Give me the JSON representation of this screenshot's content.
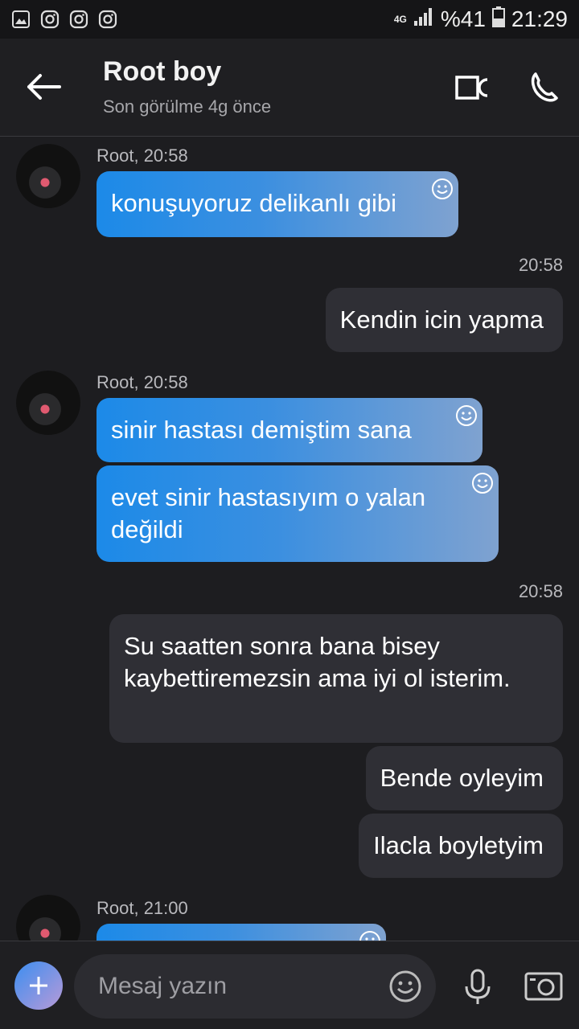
{
  "status_bar": {
    "network": "4G",
    "battery": "%41",
    "time": "21:29",
    "icons": [
      "gallery-icon",
      "instagram-icon",
      "instagram-icon",
      "instagram-icon"
    ]
  },
  "header": {
    "title": "Root boy",
    "subtitle": "Son görülme 4g önce"
  },
  "messages": [
    {
      "type": "incoming",
      "sender_time": "Root, 20:58",
      "bubbles": [
        "konuşuyoruz delikanlı gibi"
      ]
    },
    {
      "type": "outgoing",
      "time": "20:58",
      "bubbles": [
        "Kendin icin yapma"
      ]
    },
    {
      "type": "incoming",
      "sender_time": "Root, 20:58",
      "bubbles": [
        "sinir hastası demiştim sana",
        "evet sinir hastasıyım o yalan değildi"
      ]
    },
    {
      "type": "outgoing",
      "time": "20:58",
      "bubbles": [
        "Su saatten sonra bana bisey kaybettiremezsin ama iyi ol isterim.",
        "Bende oyleyim",
        "Ilacla boyletyim"
      ]
    },
    {
      "type": "incoming",
      "sender_time": "Root, 21:00",
      "bubbles": [
        ""
      ]
    }
  ],
  "composer": {
    "placeholder": "Mesaj yazın"
  },
  "colors": {
    "background": "#1d1d20",
    "incoming_bubble_start": "#1c8ae8",
    "incoming_bubble_end": "#7fa2d0",
    "outgoing_bubble": "#2f2f35"
  }
}
